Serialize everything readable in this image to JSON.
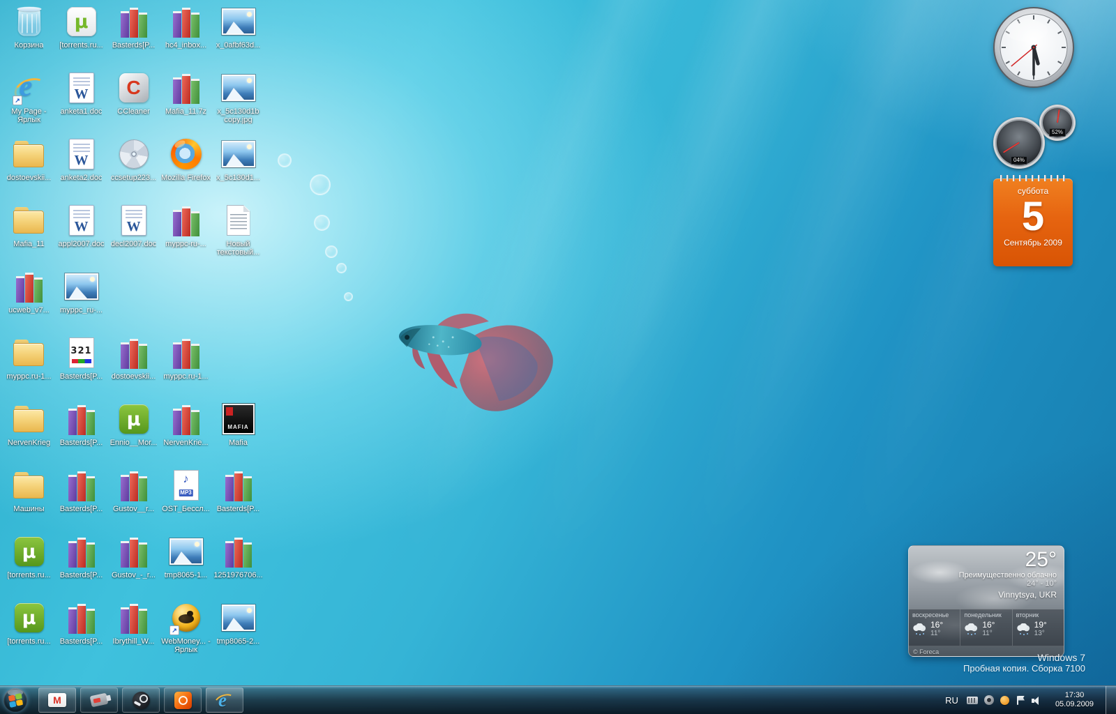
{
  "desktop": {
    "watermark_line1": "Windows 7",
    "watermark_line2": "Пробная копия. Сборка 7100",
    "icons": [
      {
        "label": "Корзина",
        "type": "recycle-bin",
        "row": 1,
        "col": 1
      },
      {
        "label": "[torrents.ru...",
        "type": "utorrent-white",
        "row": 1,
        "col": 2
      },
      {
        "label": "Basterds[P...",
        "type": "winrar",
        "row": 1,
        "col": 3
      },
      {
        "label": "hc4_inbox...",
        "type": "winrar",
        "row": 1,
        "col": 4
      },
      {
        "label": "x_0afbf63d...",
        "type": "image",
        "row": 1,
        "col": 5
      },
      {
        "label": "My Page - Ярлык",
        "type": "ie",
        "row": 2,
        "col": 1,
        "shortcut": true
      },
      {
        "label": "anketa1.doc",
        "type": "word",
        "row": 2,
        "col": 2
      },
      {
        "label": "CCleaner",
        "type": "ccleaner",
        "row": 2,
        "col": 3
      },
      {
        "label": "Mafia_11.7z",
        "type": "winrar",
        "row": 2,
        "col": 4
      },
      {
        "label": "x_5c130d1b copy.jpg",
        "type": "image",
        "row": 2,
        "col": 5
      },
      {
        "label": "dostoevskii...",
        "type": "folder",
        "row": 3,
        "col": 1
      },
      {
        "label": "anketa2.doc",
        "type": "word",
        "row": 3,
        "col": 2
      },
      {
        "label": "ccsetup223...",
        "type": "cd",
        "row": 3,
        "col": 3
      },
      {
        "label": "Mozilla Firefox",
        "type": "firefox",
        "row": 3,
        "col": 4
      },
      {
        "label": "x_5c130d1...",
        "type": "image",
        "row": 3,
        "col": 5
      },
      {
        "label": "Mafia_11",
        "type": "folder",
        "row": 4,
        "col": 1
      },
      {
        "label": "appl2007.doc",
        "type": "word",
        "row": 4,
        "col": 2
      },
      {
        "label": "decl2007.doc",
        "type": "word",
        "row": 4,
        "col": 3
      },
      {
        "label": "myppc-ru-...",
        "type": "winrar",
        "row": 4,
        "col": 4
      },
      {
        "label": "Новый текстовый...",
        "type": "text-file",
        "row": 4,
        "col": 5
      },
      {
        "label": "ucweb_v7...",
        "type": "winrar",
        "row": 5,
        "col": 1
      },
      {
        "label": "myppc_ru-...",
        "type": "image",
        "row": 5,
        "col": 2
      },
      {
        "label": "myppc.ru-1...",
        "type": "folder",
        "row": 6,
        "col": 1
      },
      {
        "label": "Basterds[P...",
        "type": "file-321",
        "row": 6,
        "col": 2
      },
      {
        "label": "dostoevskii...",
        "type": "winrar",
        "row": 6,
        "col": 3
      },
      {
        "label": "myppc.ru-1...",
        "type": "winrar",
        "row": 6,
        "col": 4
      },
      {
        "label": "NervenKrieg",
        "type": "folder",
        "row": 7,
        "col": 1
      },
      {
        "label": "Basterds[P...",
        "type": "winrar",
        "row": 7,
        "col": 2
      },
      {
        "label": "Ennio__Mor...",
        "type": "utorrent-green",
        "row": 7,
        "col": 3
      },
      {
        "label": "NervenKrie...",
        "type": "winrar",
        "row": 7,
        "col": 4
      },
      {
        "label": "Mafia",
        "type": "mafia-image",
        "row": 7,
        "col": 5
      },
      {
        "label": "Машины",
        "type": "folder",
        "row": 8,
        "col": 1
      },
      {
        "label": "Basterds[P...",
        "type": "winrar",
        "row": 8,
        "col": 2
      },
      {
        "label": "Gustov__r...",
        "type": "winrar",
        "row": 8,
        "col": 3
      },
      {
        "label": "OST_Бессл...",
        "type": "mp3",
        "row": 8,
        "col": 4
      },
      {
        "label": "Basterds[P...",
        "type": "winrar",
        "row": 8,
        "col": 5
      },
      {
        "label": "[torrents.ru...",
        "type": "utorrent-green",
        "row": 9,
        "col": 1
      },
      {
        "label": "Basterds[P...",
        "type": "winrar",
        "row": 9,
        "col": 2
      },
      {
        "label": "Gustov_-_r...",
        "type": "winrar",
        "row": 9,
        "col": 3
      },
      {
        "label": "tmp8065-1...",
        "type": "image",
        "row": 9,
        "col": 4
      },
      {
        "label": "1251976706...",
        "type": "winrar",
        "row": 9,
        "col": 5
      },
      {
        "label": "[torrents.ru...",
        "type": "utorrent-green",
        "row": 10,
        "col": 1
      },
      {
        "label": "Basterds[P...",
        "type": "winrar",
        "row": 10,
        "col": 2
      },
      {
        "label": "Ibrythill_W...",
        "type": "winrar",
        "row": 10,
        "col": 3
      },
      {
        "label": "WebMoney... - Ярлык",
        "type": "webmoney",
        "row": 10,
        "col": 4,
        "shortcut": true
      },
      {
        "label": "tmp8065-2...",
        "type": "image",
        "row": 10,
        "col": 5
      }
    ]
  },
  "gadgets": {
    "meter": {
      "cpu": "04%",
      "ram": "52%"
    },
    "calendar": {
      "weekday": "суббота",
      "day": "5",
      "month": "Сентябрь 2009"
    },
    "weather": {
      "temp": "25°",
      "condition": "Преимущественно облачно",
      "range": "24° - 10°",
      "location": "Vinnytsya, UKR",
      "credit": "© Foreca",
      "forecast": [
        {
          "day": "воскресенье",
          "high": "16°",
          "low": "11°"
        },
        {
          "day": "понедельник",
          "high": "16°",
          "low": "11°"
        },
        {
          "day": "вторник",
          "high": "19°",
          "low": "13°"
        }
      ]
    }
  },
  "taskbar": {
    "pinned_icons": [
      "mail",
      "usb-device",
      "steam",
      "media-player",
      "internet-explorer"
    ],
    "tray": {
      "language": "RU",
      "icons": [
        "keyboard",
        "steam-tray",
        "update",
        "action-center-flag",
        "volume"
      ],
      "time": "17:30",
      "date": "05.09.2009"
    }
  },
  "colors": {
    "calendar_accent": "#e66410",
    "wallpaper_accent": "#35b4d6",
    "taskbar_glass": "#141e2a"
  }
}
